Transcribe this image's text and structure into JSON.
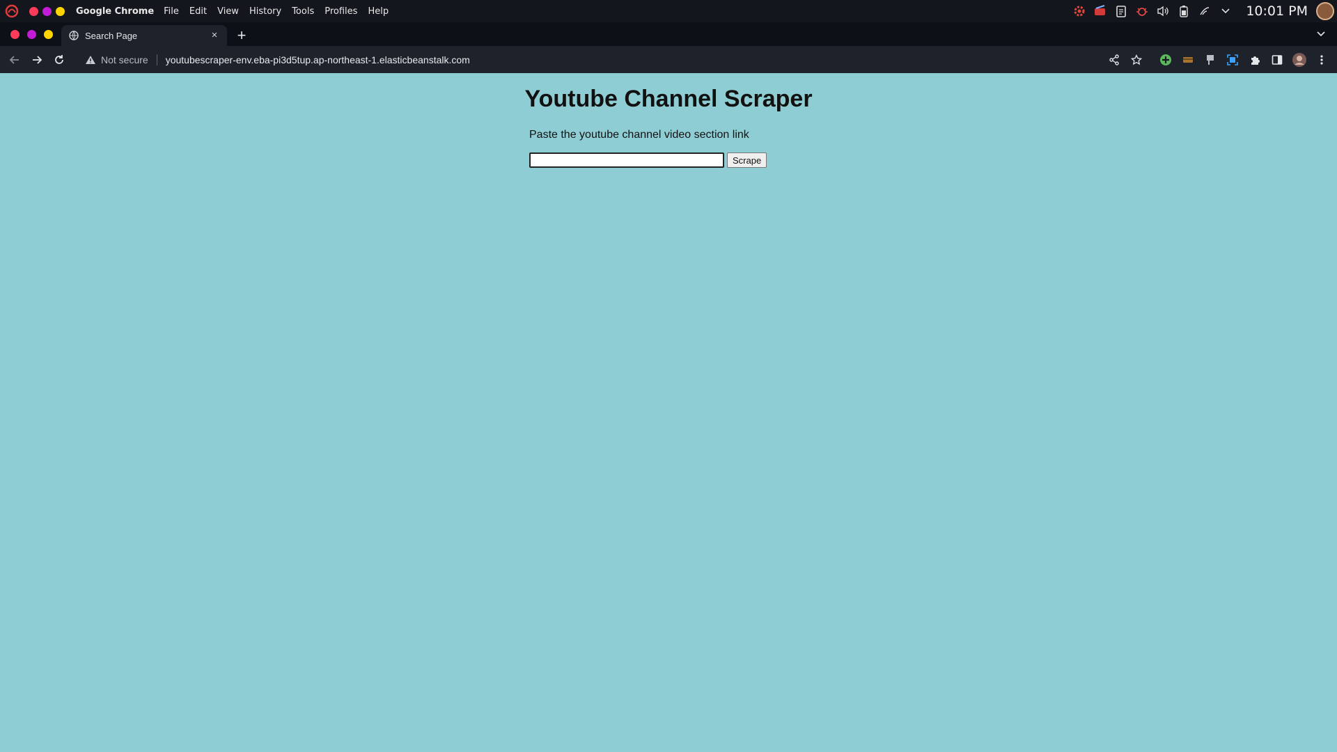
{
  "os": {
    "app_name": "Google Chrome",
    "menus": [
      "File",
      "Edit",
      "View",
      "History",
      "Tools",
      "Profiles",
      "Help"
    ],
    "clock": "10:01 PM",
    "tray_icons": [
      "settings-cog-icon",
      "notification-badge-icon",
      "clipboard-icon",
      "bug-icon",
      "volume-icon",
      "battery-icon",
      "wifi-icon",
      "chevron-down-icon"
    ],
    "dot_colors": [
      "#ff3b5c",
      "#c41cd6",
      "#ffd400"
    ]
  },
  "browser": {
    "tab": {
      "title": "Search Page",
      "close": "×"
    },
    "new_tab": "+",
    "security_label": "Not secure",
    "url": "youtubescraper-env.eba-pi3d5tup.ap-northeast-1.elasticbeanstalk.com"
  },
  "page": {
    "heading": "Youtube Channel Scraper",
    "instruction": "Paste the youtube channel video section link",
    "input_value": "",
    "button_label": "Scrape",
    "background": "#8fcdd4"
  }
}
